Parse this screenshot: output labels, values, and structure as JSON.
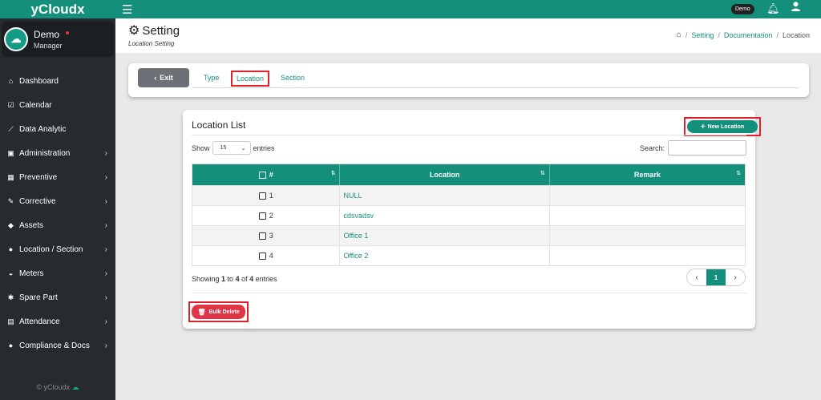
{
  "app": {
    "brand": "yCloudx",
    "footer": "© yCloudx"
  },
  "user": {
    "name": "Demo",
    "role": "Manager",
    "badge": "Demo"
  },
  "sidebar": {
    "items": [
      {
        "label": "Dashboard",
        "icon": "home-icon",
        "glyph": "⌂",
        "chevron": false
      },
      {
        "label": "Calendar",
        "icon": "calendar-check-icon",
        "glyph": "☑",
        "chevron": false
      },
      {
        "label": "Data Analytic",
        "icon": "line-chart-icon",
        "glyph": "⟋",
        "chevron": false
      },
      {
        "label": "Administration",
        "icon": "id-card-icon",
        "glyph": "▣",
        "chevron": true
      },
      {
        "label": "Preventive",
        "icon": "calendar-icon",
        "glyph": "▦",
        "chevron": true
      },
      {
        "label": "Corrective",
        "icon": "wrench-icon",
        "glyph": "✎",
        "chevron": true
      },
      {
        "label": "Assets",
        "icon": "tag-icon",
        "glyph": "◆",
        "chevron": true
      },
      {
        "label": "Location / Section",
        "icon": "globe-icon",
        "glyph": "●",
        "chevron": true
      },
      {
        "label": "Meters",
        "icon": "tachometer-icon",
        "glyph": "◒",
        "chevron": true
      },
      {
        "label": "Spare Part",
        "icon": "cogs-icon",
        "glyph": "✱",
        "chevron": true
      },
      {
        "label": "Attendance",
        "icon": "building-icon",
        "glyph": "▤",
        "chevron": true
      },
      {
        "label": "Compliance & Docs",
        "icon": "circle-icon",
        "glyph": "●",
        "chevron": true
      }
    ]
  },
  "header": {
    "title": "Setting",
    "subtitle": "Location Setting",
    "breadcrumb": {
      "setting": "Setting",
      "documentation": "Documentation",
      "current": "Location"
    }
  },
  "tabs": {
    "exit_label": "Exit",
    "type": "Type",
    "location": "Location",
    "section": "Section"
  },
  "list": {
    "title": "Location List",
    "new_button": "New Location",
    "show_label": "Show",
    "entries_value": "15",
    "entries_label": "entries",
    "search_label": "Search:",
    "columns": {
      "number": "#",
      "location": "Location",
      "remark": "Remark"
    },
    "rows": [
      {
        "num": "1",
        "location": "NULL",
        "remark": ""
      },
      {
        "num": "2",
        "location": "cdsvadsv",
        "remark": ""
      },
      {
        "num": "3",
        "location": "Office 1",
        "remark": ""
      },
      {
        "num": "4",
        "location": "Office 2",
        "remark": ""
      }
    ],
    "showing": {
      "prefix": "Showing ",
      "from": "1",
      "to_word": " to ",
      "to": "4",
      "of_word": " of ",
      "total": "4",
      "suffix": " entries"
    },
    "page": "1",
    "bulk_delete": "Bulk Delete"
  },
  "colors": {
    "primary": "#138f7c",
    "sidebar": "#262b2e",
    "danger": "#df3647",
    "highlight": "#e0202b"
  }
}
